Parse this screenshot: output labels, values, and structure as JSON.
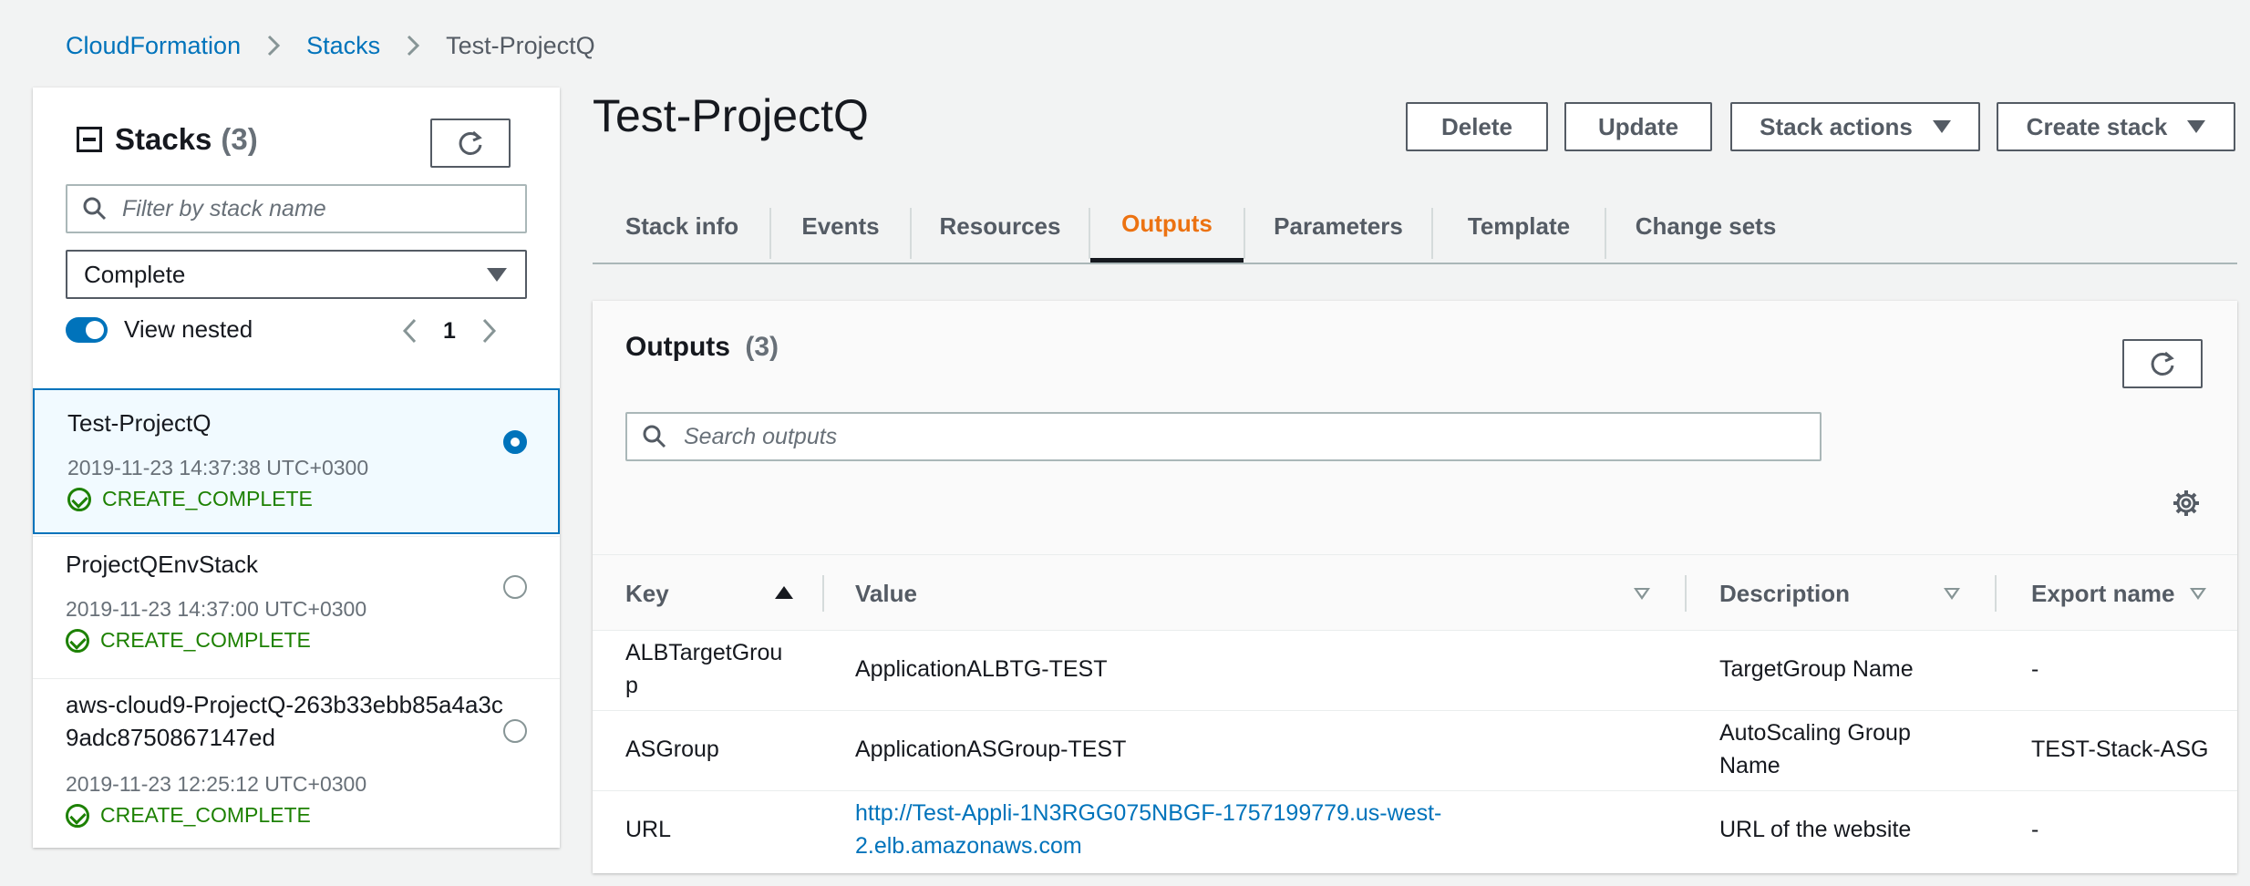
{
  "breadcrumb": {
    "items": [
      "CloudFormation",
      "Stacks",
      "Test-ProjectQ"
    ]
  },
  "sidebar": {
    "title": "Stacks",
    "count": "(3)",
    "search_placeholder": "Filter by stack name",
    "status_filter": "Complete",
    "view_nested_label": "View nested",
    "view_nested_enabled": true,
    "page": "1",
    "stacks": [
      {
        "name": "Test-ProjectQ",
        "date": "2019-11-23 14:37:38 UTC+0300",
        "status": "CREATE_COMPLETE",
        "selected": true
      },
      {
        "name": "ProjectQEnvStack",
        "date": "2019-11-23 14:37:00 UTC+0300",
        "status": "CREATE_COMPLETE",
        "selected": false
      },
      {
        "name": "aws-cloud9-ProjectQ-263b33ebb85a4a3c9adc8750867147ed",
        "date": "2019-11-23 12:25:12 UTC+0300",
        "status": "CREATE_COMPLETE",
        "selected": false
      }
    ]
  },
  "header": {
    "title": "Test-ProjectQ",
    "buttons": {
      "delete": "Delete",
      "update": "Update",
      "stack_actions": "Stack actions",
      "create_stack": "Create stack"
    }
  },
  "tabs": [
    "Stack info",
    "Events",
    "Resources",
    "Outputs",
    "Parameters",
    "Template",
    "Change sets"
  ],
  "active_tab": "Outputs",
  "outputs": {
    "title": "Outputs",
    "count": "(3)",
    "search_placeholder": "Search outputs",
    "columns": [
      "Key",
      "Value",
      "Description",
      "Export name"
    ],
    "rows": [
      {
        "key": "ALBTargetGrou\np",
        "value": "ApplicationALBTG-TEST",
        "description": "TargetGroup Name",
        "export": "-"
      },
      {
        "key": "ASGroup",
        "value": "ApplicationASGroup-TEST",
        "description": "AutoScaling Group\nName",
        "export": "TEST-Stack-ASG"
      },
      {
        "key": "URL",
        "value": "http://Test-Appli-1N3RGG075NBGF-1757199779.us-west-\n2.elb.amazonaws.com",
        "description": "URL of the website",
        "export": "-"
      }
    ]
  },
  "colors": {
    "link": "#0073bb",
    "active_tab": "#ec7211",
    "success": "#1d8102"
  }
}
